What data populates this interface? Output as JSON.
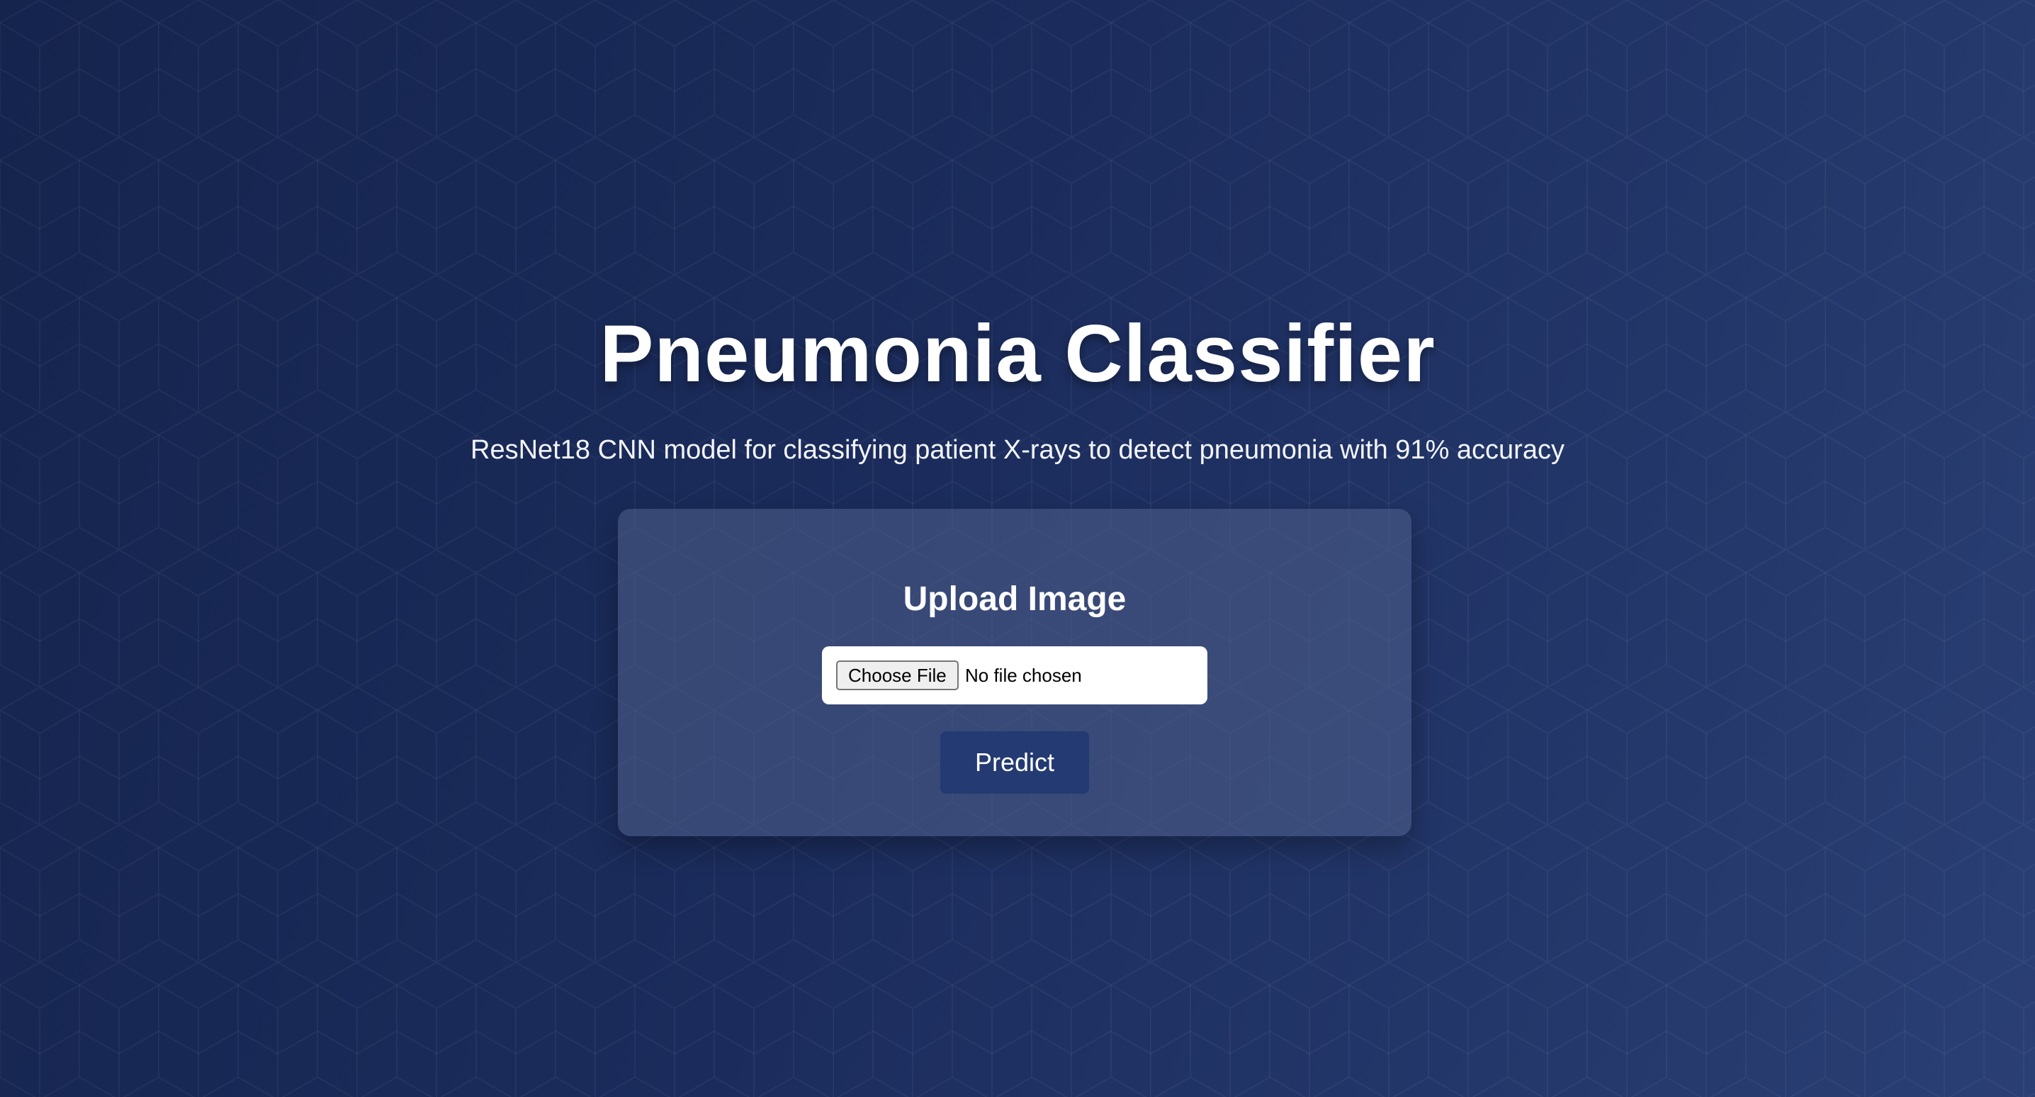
{
  "page": {
    "title": "Pneumonia Classifier",
    "subtitle": "ResNet18 CNN model for classifying patient X-rays to detect pneumonia with 91% accuracy"
  },
  "upload": {
    "heading": "Upload Image",
    "choose_file_label": "Choose File",
    "file_status": "No file chosen",
    "predict_label": "Predict"
  },
  "colors": {
    "background_start": "#15244d",
    "background_end": "#2a3f74",
    "card_background": "rgba(80, 96, 140, 0.55)",
    "predict_button": "#243a72",
    "text": "#ffffff"
  }
}
